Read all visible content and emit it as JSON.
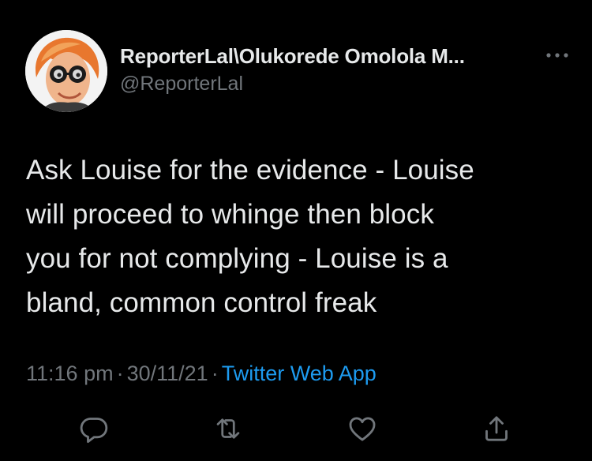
{
  "author": {
    "display_name": "ReporterLal\\Olukorede Omolola M...",
    "handle": "@ReporterLal"
  },
  "tweet": {
    "text": "Ask Louise for the evidence - Louise\nwill proceed to whinge then block\nyou for not complying - Louise is a\nbland, common control freak"
  },
  "meta": {
    "time": "11:16 pm",
    "date": "30/11/21",
    "source": "Twitter Web App",
    "separator": "·"
  },
  "icons": {
    "more": "more-horizontal-icon",
    "reply": "reply-icon",
    "retweet": "retweet-icon",
    "like": "heart-icon",
    "share": "share-icon"
  },
  "colors": {
    "background": "#000000",
    "text": "#e7e9ea",
    "secondary": "#71767b",
    "link": "#1d9bf0"
  }
}
